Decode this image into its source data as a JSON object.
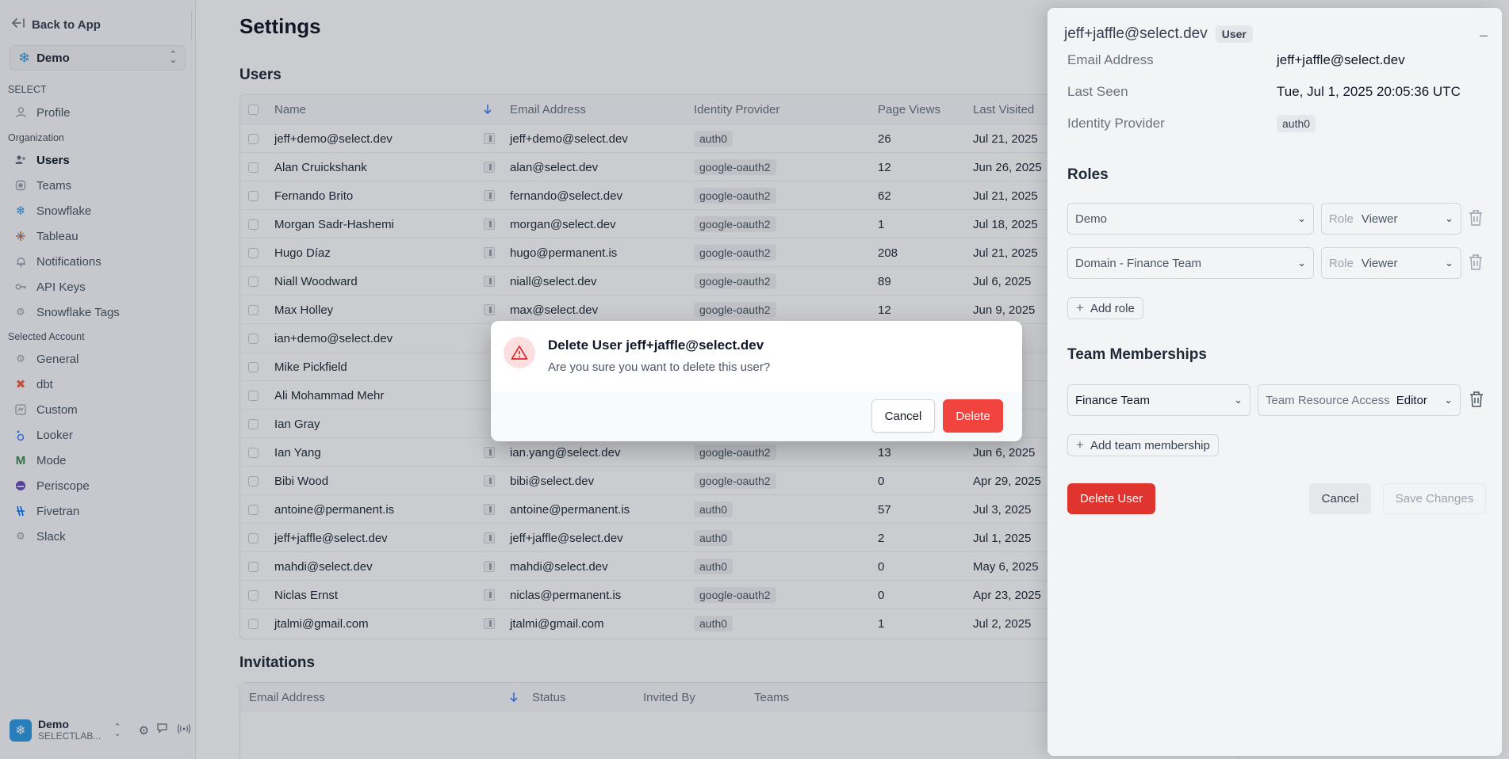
{
  "sidebar": {
    "back_label": "Back to App",
    "account": "Demo",
    "sections": {
      "select": "SELECT",
      "organization": "Organization",
      "selected_account": "Selected Account"
    },
    "items": [
      {
        "label": "Profile",
        "icon": "person-icon"
      },
      {
        "label": "Users",
        "icon": "users-icon"
      },
      {
        "label": "Teams",
        "icon": "teams-icon"
      },
      {
        "label": "Snowflake",
        "icon": "snowflake-icon"
      },
      {
        "label": "Tableau",
        "icon": "tableau-icon"
      },
      {
        "label": "Notifications",
        "icon": "bell-icon"
      },
      {
        "label": "API Keys",
        "icon": "key-icon"
      },
      {
        "label": "Snowflake Tags",
        "icon": "gear-icon"
      },
      {
        "label": "General",
        "icon": "gear-icon"
      },
      {
        "label": "dbt",
        "icon": "dbt-icon"
      },
      {
        "label": "Custom",
        "icon": "custom-icon"
      },
      {
        "label": "Looker",
        "icon": "looker-icon"
      },
      {
        "label": "Mode",
        "icon": "mode-icon"
      },
      {
        "label": "Periscope",
        "icon": "periscope-icon"
      },
      {
        "label": "Fivetran",
        "icon": "fivetran-icon"
      },
      {
        "label": "Slack",
        "icon": "gear-icon"
      }
    ],
    "footer": {
      "name": "Demo",
      "sub": "SELECTLAB..."
    }
  },
  "page": {
    "title": "Settings"
  },
  "users": {
    "heading": "Users",
    "columns": {
      "name": "Name",
      "email": "Email Address",
      "idp": "Identity Provider",
      "views": "Page Views",
      "visited": "Last Visited"
    },
    "rows": [
      {
        "name": "jeff+demo@select.dev",
        "email": "jeff+demo@select.dev",
        "idp": "auth0",
        "views": "26",
        "visited": "Jul 21, 2025"
      },
      {
        "name": "Alan Cruickshank",
        "email": "alan@select.dev",
        "idp": "google-oauth2",
        "views": "12",
        "visited": "Jun 26, 2025"
      },
      {
        "name": "Fernando Brito",
        "email": "fernando@select.dev",
        "idp": "google-oauth2",
        "views": "62",
        "visited": "Jul 21, 2025"
      },
      {
        "name": "Morgan Sadr-Hashemi",
        "email": "morgan@select.dev",
        "idp": "google-oauth2",
        "views": "1",
        "visited": "Jul 18, 2025"
      },
      {
        "name": "Hugo Díaz",
        "email": "hugo@permanent.is",
        "idp": "google-oauth2",
        "views": "208",
        "visited": "Jul 21, 2025"
      },
      {
        "name": "Niall Woodward",
        "email": "niall@select.dev",
        "idp": "google-oauth2",
        "views": "89",
        "visited": "Jul 6, 2025"
      },
      {
        "name": "Max Holley",
        "email": "max@select.dev",
        "idp": "google-oauth2",
        "views": "12",
        "visited": "Jun 9, 2025"
      },
      {
        "name": "ian+demo@select.dev",
        "email": "",
        "idp": "",
        "views": "",
        "visited": "025"
      },
      {
        "name": "Mike Pickfield",
        "email": "",
        "idp": "",
        "views": "",
        "visited": "025"
      },
      {
        "name": "Ali Mohammad Mehr",
        "email": "",
        "idp": "",
        "views": "",
        "visited": "2025"
      },
      {
        "name": "Ian Gray",
        "email": "",
        "idp": "",
        "views": "",
        "visited": ""
      },
      {
        "name": "Ian Yang",
        "email": "ian.yang@select.dev",
        "idp": "google-oauth2",
        "views": "13",
        "visited": "Jun 6, 2025"
      },
      {
        "name": "Bibi Wood",
        "email": "bibi@select.dev",
        "idp": "google-oauth2",
        "views": "0",
        "visited": "Apr 29, 2025"
      },
      {
        "name": "antoine@permanent.is",
        "email": "antoine@permanent.is",
        "idp": "auth0",
        "views": "57",
        "visited": "Jul 3, 2025"
      },
      {
        "name": "jeff+jaffle@select.dev",
        "email": "jeff+jaffle@select.dev",
        "idp": "auth0",
        "views": "2",
        "visited": "Jul 1, 2025"
      },
      {
        "name": "mahdi@select.dev",
        "email": "mahdi@select.dev",
        "idp": "auth0",
        "views": "0",
        "visited": "May 6, 2025"
      },
      {
        "name": "Niclas Ernst",
        "email": "niclas@permanent.is",
        "idp": "google-oauth2",
        "views": "0",
        "visited": "Apr 23, 2025"
      },
      {
        "name": "jtalmi@gmail.com",
        "email": "jtalmi@gmail.com",
        "idp": "auth0",
        "views": "1",
        "visited": "Jul 2, 2025"
      }
    ]
  },
  "invitations": {
    "heading": "Invitations",
    "columns": {
      "email": "Email Address",
      "status": "Status",
      "invited_by": "Invited By",
      "teams": "Teams"
    }
  },
  "drawer": {
    "title": "jeff+jaffle@select.dev",
    "badge": "User",
    "email_label": "Email Address",
    "email_value": "jeff+jaffle@select.dev",
    "seen_label": "Last Seen",
    "seen_value": "Tue, Jul 1, 2025 20:05:36 UTC",
    "idp_label": "Identity Provider",
    "idp_value": "auth0",
    "roles_heading": "Roles",
    "roles": [
      {
        "scope": "Demo",
        "role_label": "Role",
        "role": "Viewer"
      },
      {
        "scope": "Domain - Finance Team",
        "role_label": "Role",
        "role": "Viewer"
      }
    ],
    "add_role": "Add role",
    "team_heading": "Team Memberships",
    "team": {
      "name": "Finance Team",
      "access_label": "Team Resource Access",
      "access": "Editor"
    },
    "add_team": "Add team membership",
    "delete_user": "Delete User",
    "cancel": "Cancel",
    "save": "Save Changes"
  },
  "modal": {
    "title": "Delete User jeff+jaffle@select.dev",
    "body": "Are you sure you want to delete this user?",
    "cancel": "Cancel",
    "delete": "Delete"
  },
  "colors": {
    "danger": "#e0352f",
    "danger_light": "#f2443f",
    "accent": "#2f9be0"
  }
}
